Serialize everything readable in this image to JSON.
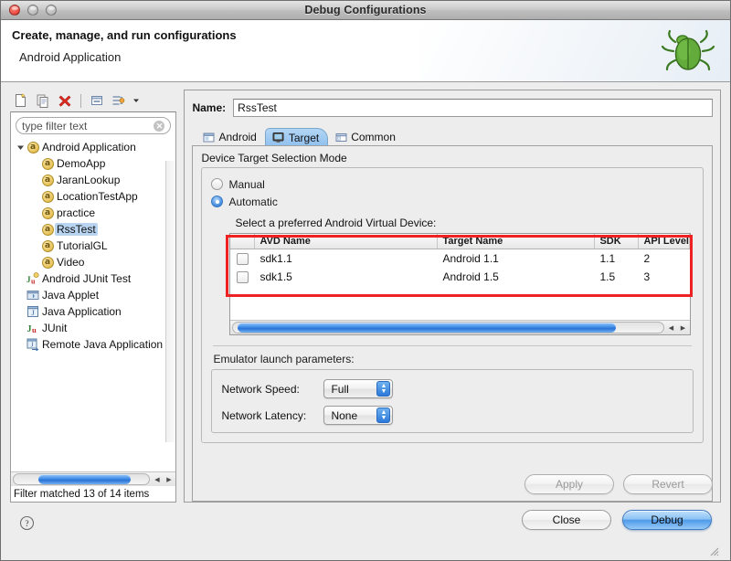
{
  "window": {
    "title": "Debug Configurations",
    "traffic_lights": [
      "close-button",
      "minimize-button",
      "zoom-button"
    ]
  },
  "header": {
    "title": "Create, manage, and run configurations",
    "subtitle": "Android Application",
    "icon": "green-bug-icon"
  },
  "tree_toolbar": {
    "buttons": [
      {
        "name": "new-launch-configuration-button",
        "icon": "new-document-icon"
      },
      {
        "name": "duplicate-configuration-button",
        "icon": "copy-icon"
      },
      {
        "name": "delete-configuration-button",
        "icon": "red-x-icon"
      },
      {
        "name": "collapse-all-button",
        "icon": "collapse-all-icon"
      },
      {
        "name": "filter-configurations-button",
        "icon": "filter-icon"
      }
    ]
  },
  "filter": {
    "placeholder": "type filter text",
    "value": "",
    "clear_icon": "clear-circle-icon",
    "status": "Filter matched 13 of 14 items"
  },
  "tree": {
    "items": [
      {
        "label": "Android Application",
        "icon": "android-icon",
        "depth": 0,
        "expanded": true,
        "selected": false
      },
      {
        "label": "DemoApp",
        "icon": "android-icon",
        "depth": 1,
        "expanded": false,
        "selected": false
      },
      {
        "label": "JaranLookup",
        "icon": "android-icon",
        "depth": 1,
        "expanded": false,
        "selected": false
      },
      {
        "label": "LocationTestApp",
        "icon": "android-icon",
        "depth": 1,
        "expanded": false,
        "selected": false
      },
      {
        "label": "practice",
        "icon": "android-icon",
        "depth": 1,
        "expanded": false,
        "selected": false
      },
      {
        "label": "RssTest",
        "icon": "android-icon",
        "depth": 1,
        "expanded": false,
        "selected": true
      },
      {
        "label": "TutorialGL",
        "icon": "android-icon",
        "depth": 1,
        "expanded": false,
        "selected": false
      },
      {
        "label": "Video",
        "icon": "android-icon",
        "depth": 1,
        "expanded": false,
        "selected": false
      },
      {
        "label": "Android JUnit Test",
        "icon": "junit-android-icon",
        "depth": 0,
        "expanded": false,
        "selected": false
      },
      {
        "label": "Java Applet",
        "icon": "java-applet-icon",
        "depth": 0,
        "expanded": false,
        "selected": false
      },
      {
        "label": "Java Application",
        "icon": "java-application-icon",
        "depth": 0,
        "expanded": false,
        "selected": false
      },
      {
        "label": "JUnit",
        "icon": "junit-icon",
        "depth": 0,
        "expanded": false,
        "selected": false
      },
      {
        "label": "Remote Java Application",
        "icon": "remote-java-icon",
        "depth": 0,
        "expanded": false,
        "selected": false
      }
    ]
  },
  "config": {
    "name_label": "Name:",
    "name_value": "RssTest",
    "tabs": [
      {
        "label": "Android",
        "icon": "android-tab-icon",
        "active": false
      },
      {
        "label": "Target",
        "icon": "target-monitor-icon",
        "active": true
      },
      {
        "label": "Common",
        "icon": "common-window-icon",
        "active": false
      }
    ],
    "target_tab": {
      "group_title": "Device Target Selection Mode",
      "modes": [
        {
          "label": "Manual",
          "selected": false
        },
        {
          "label": "Automatic",
          "selected": true
        }
      ],
      "avd_label": "Select a preferred Android Virtual Device:",
      "table": {
        "columns": [
          "",
          "AVD Name",
          "Target Name",
          "SDK",
          "API Level"
        ],
        "rows": [
          {
            "checked": false,
            "avd_name": "sdk1.1",
            "target_name": "Android 1.1",
            "sdk": "1.1",
            "api_level": "2"
          },
          {
            "checked": false,
            "avd_name": "sdk1.5",
            "target_name": "Android 1.5",
            "sdk": "1.5",
            "api_level": "3"
          }
        ]
      },
      "emulator_title": "Emulator launch parameters:",
      "emulator_fields": [
        {
          "label": "Network Speed:",
          "value": "Full"
        },
        {
          "label": "Network Latency:",
          "value": "None"
        }
      ]
    },
    "apply_label": "Apply",
    "revert_label": "Revert"
  },
  "footer": {
    "help_icon": "help-question-icon",
    "close_label": "Close",
    "debug_label": "Debug",
    "resize_grip": "resize-grip-icon"
  },
  "colors": {
    "annotation_red": "#ee2222",
    "selection_blue": "#b8d4f0",
    "aqua_blue": "#4a95ec",
    "active_tab_blue": "#8fc0ee"
  }
}
